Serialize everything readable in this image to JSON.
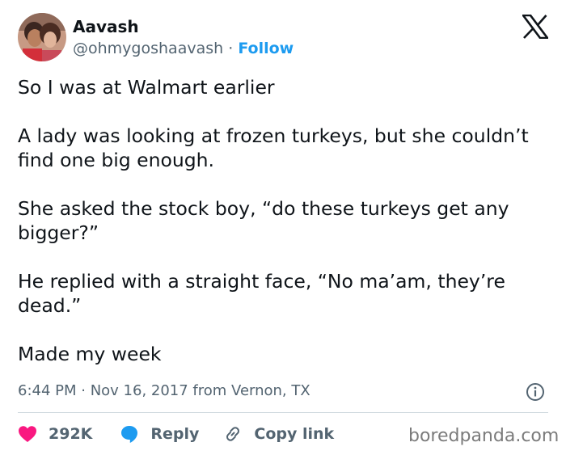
{
  "author": {
    "name": "Aavash",
    "handle": "@ohmygoshaavash",
    "separator": "·",
    "follow_label": "Follow"
  },
  "icons": {
    "brand": "x-logo-icon",
    "info": "info-icon",
    "like": "heart-icon",
    "reply": "reply-bubble-icon",
    "copy": "link-icon"
  },
  "tweet": {
    "paragraphs": [
      "So I was at Walmart earlier",
      "A lady was looking at frozen turkeys, but she couldn’t find one big enough.",
      "She asked the stock boy, “do these turkeys get any bigger?”",
      "He replied with a straight face, “No ma’am, they’re dead.”",
      "Made my week"
    ],
    "meta": "6:44 PM · Nov 16, 2017 from Vernon, TX"
  },
  "actions": {
    "likes_count": "292K",
    "reply_label": "Reply",
    "copy_label": "Copy link"
  },
  "watermark": "boredpanda.com",
  "colors": {
    "text": "#0f1419",
    "secondary": "#536471",
    "follow": "#1d9bf0",
    "like": "#f91880",
    "reply": "#1d9bf0",
    "divider": "#cfd9de"
  }
}
